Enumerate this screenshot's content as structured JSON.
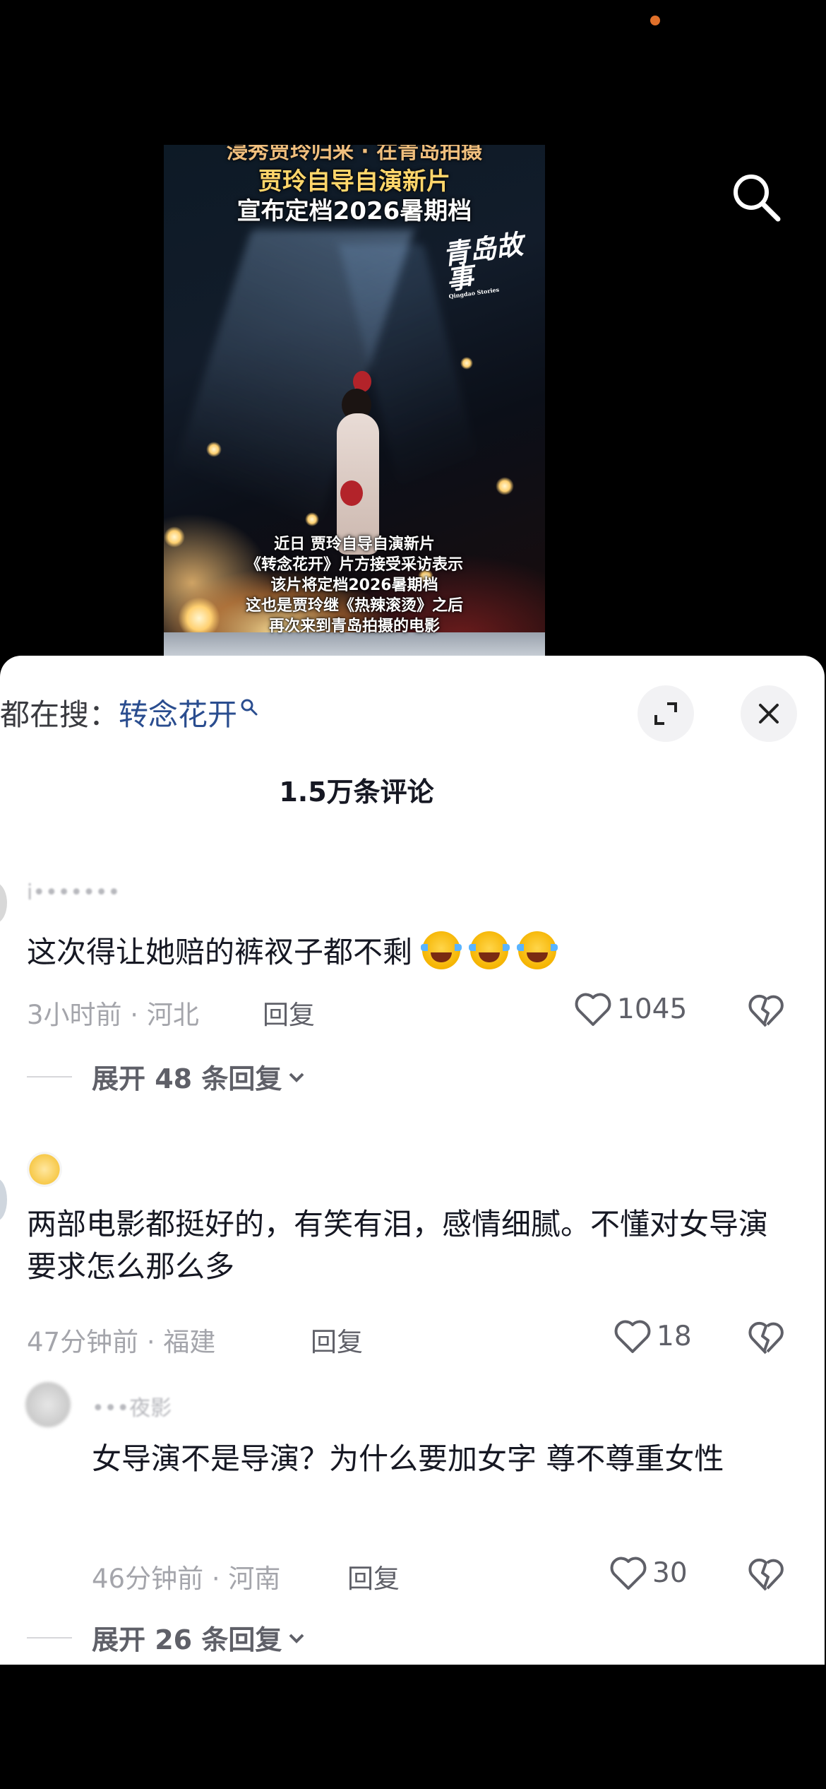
{
  "video": {
    "top_cut_text": "浸秀贾玲归来 · 在青岛拍摄",
    "title_line1": "贾玲自导自演新片",
    "title_line2": "宣布定档2026暑期档",
    "brand_logo": "青岛故事",
    "brand_logo_sub": "Qingdao Stories",
    "caption_lines": [
      "近日 贾玲自导自演新片",
      "《转念花开》片方接受采访表示",
      "该片将定档2026暑期档",
      "这也是贾玲继《热辣滚烫》之后",
      "再次来到青岛拍摄的电影"
    ]
  },
  "comments_panel": {
    "search_prefix": "都在搜：",
    "search_term": "转念花开",
    "title": "1.5万条评论",
    "comments": [
      {
        "username": "i•••••••",
        "text": "这次得让她赔的裤衩子都不剩",
        "emoji": "cry-laughing-emoji",
        "meta": "3小时前 · 河北",
        "reply_label": "回复",
        "likes": "1045",
        "expand_label": "展开 48 条回复"
      },
      {
        "username": "",
        "text": "两部电影都挺好的，有笑有泪，感情细腻。不懂对女导演要求怎么那么多",
        "meta": "47分钟前 · 福建",
        "reply_label": "回复",
        "likes": "18"
      },
      {
        "username": "•••夜影",
        "text": "女导演不是导演？为什么要加女字 尊不尊重女性",
        "meta": "46分钟前 · 河南",
        "reply_label": "回复",
        "likes": "30",
        "expand_label": "展开 26 条回复"
      }
    ]
  },
  "colors": {
    "search_term": "#2a4d8f",
    "meta": "#a4a5ab",
    "text": "#161823",
    "notification_dot": "#e0702a"
  }
}
